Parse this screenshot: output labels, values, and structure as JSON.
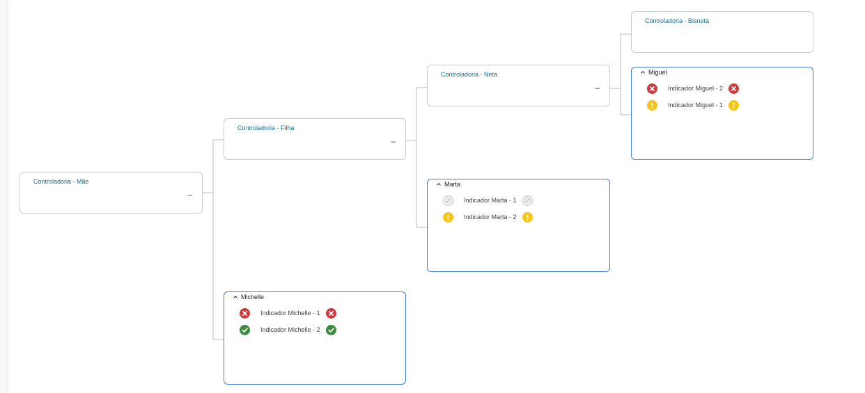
{
  "colors": {
    "error": "#d03a3c",
    "warning": "#f5c518",
    "success": "#3d8b3d",
    "disabled": "#c8c8c8",
    "unit_title": "#1d6f8a",
    "person_border": "#3f7fd6"
  },
  "units": {
    "mae": {
      "title": "Controladoria - Mãe",
      "collapse": "–"
    },
    "filha": {
      "title": "Controladoria - Filha",
      "collapse": "–"
    },
    "neta": {
      "title": "Controladoria - Neta",
      "collapse": "–"
    },
    "bisneta": {
      "title": "Controladoria - Bisneta"
    }
  },
  "people": {
    "miguel": {
      "name": "Miguel",
      "indicators": [
        {
          "label": "Indicador Miguel - 2",
          "status": "error"
        },
        {
          "label": "Indicador Miguel - 1",
          "status": "warning"
        }
      ]
    },
    "marta": {
      "name": "Marta",
      "indicators": [
        {
          "label": "Indicador Marta - 1",
          "status": "disabled"
        },
        {
          "label": "Indicador Marta - 2",
          "status": "warning"
        }
      ]
    },
    "michelle": {
      "name": "Michelle",
      "indicators": [
        {
          "label": "Indicador Michelle - 1",
          "status": "error"
        },
        {
          "label": "Indicador Michelle - 2",
          "status": "success"
        }
      ]
    }
  }
}
